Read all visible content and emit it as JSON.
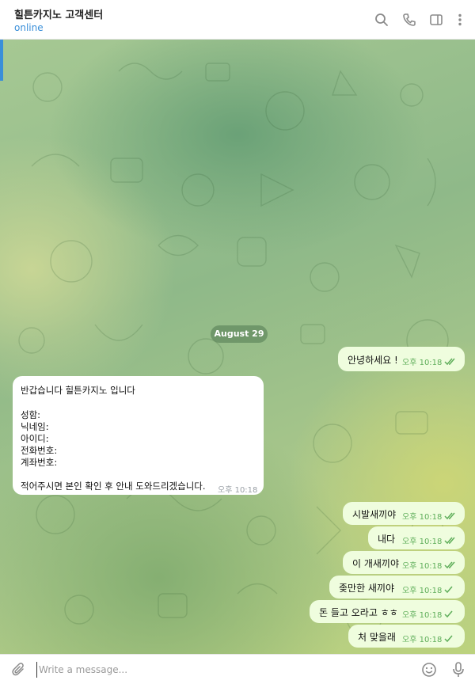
{
  "header": {
    "title": "힐튼카지노 고객센터",
    "status": "online",
    "icons": [
      "search-icon",
      "phone-icon",
      "sidebar-toggle-icon",
      "more-vertical-icon"
    ]
  },
  "chat": {
    "date_divider": "August 29",
    "messages": [
      {
        "direction": "out",
        "text": "안녕하세요 !",
        "time": "오후 10:18",
        "status": "read"
      },
      {
        "direction": "in",
        "lines": [
          "반갑습니다 힐튼카지노 입니다",
          "",
          "성함:",
          "닉네임:",
          "아이디:",
          "전화번호:",
          "계좌번호:",
          "",
          "적어주시면 본인 확인 후 안내 도와드리겠습니다."
        ],
        "time": "오후 10:18"
      },
      {
        "direction": "out",
        "text": "시발새끼야",
        "time": "오후 10:18",
        "status": "read"
      },
      {
        "direction": "out",
        "text": "내다",
        "time": "오후 10:18",
        "status": "read"
      },
      {
        "direction": "out",
        "text": "이 개새끼야",
        "time": "오후 10:18",
        "status": "read"
      },
      {
        "direction": "out",
        "text": "좆만한 새끼야",
        "time": "오후 10:18",
        "status": "sent"
      },
      {
        "direction": "out",
        "text": "돈 들고 오라고 ㅎㅎ",
        "time": "오후 10:18",
        "status": "sent"
      },
      {
        "direction": "out",
        "text": "처 맞을래",
        "time": "오후 10:18",
        "status": "sent"
      }
    ]
  },
  "composer": {
    "placeholder": "Write a message...",
    "icons": [
      "paperclip-icon",
      "emoji-icon",
      "microphone-icon"
    ]
  },
  "colors": {
    "accent": "#3a8fd9",
    "outgoing_bubble": "#effdde",
    "incoming_bubble": "#ffffff",
    "check_green": "#5fae5a"
  }
}
